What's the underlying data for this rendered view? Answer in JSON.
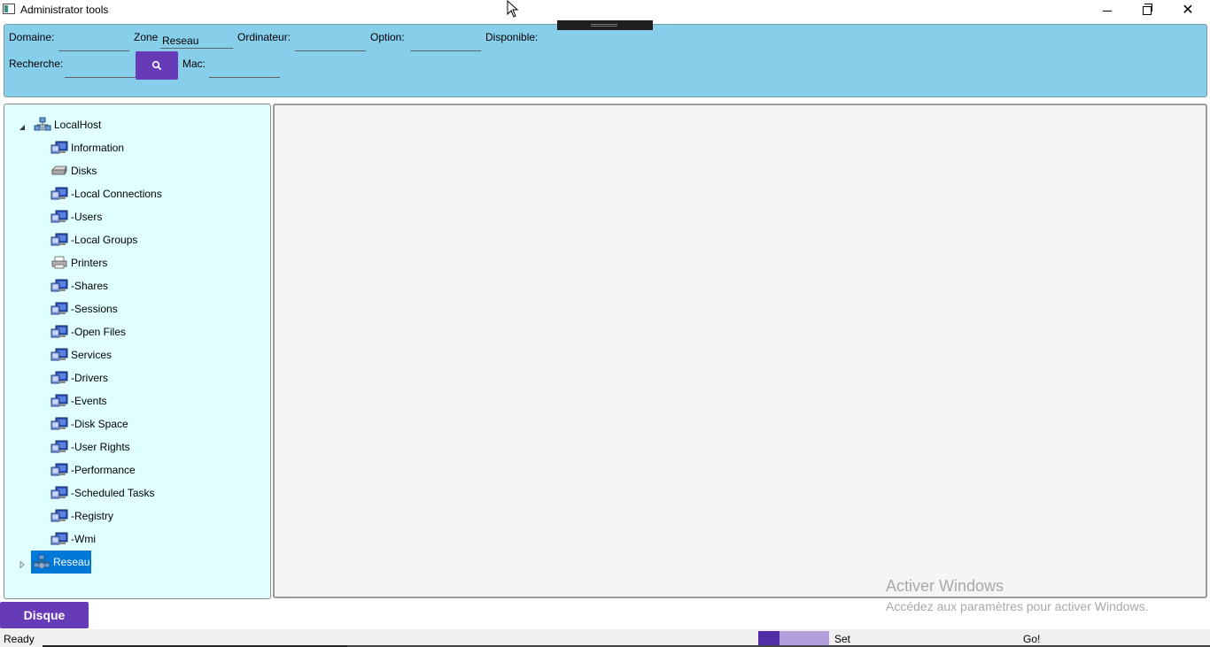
{
  "window": {
    "title": "Administrator tools"
  },
  "filters": {
    "domaine_label": "Domaine:",
    "zone_label": "Zone",
    "zone_value": "Reseau",
    "ordinateur_label": "Ordinateur:",
    "option_label": "Option:",
    "disponible_label": "Disponible:",
    "recherche_label": "Recherche:",
    "mac_label": "Mac:"
  },
  "tree": {
    "root": "LocalHost",
    "items": [
      {
        "label": "Information",
        "icon": "computer-icon"
      },
      {
        "label": "Disks",
        "icon": "disk-icon"
      },
      {
        "label": "-Local Connections",
        "icon": "computer-icon"
      },
      {
        "label": "-Users",
        "icon": "computer-icon"
      },
      {
        "label": "-Local Groups",
        "icon": "computer-icon"
      },
      {
        "label": "Printers",
        "icon": "printer-icon"
      },
      {
        "label": "-Shares",
        "icon": "computer-icon"
      },
      {
        "label": "-Sessions",
        "icon": "computer-icon"
      },
      {
        "label": "-Open Files",
        "icon": "computer-icon"
      },
      {
        "label": "Services",
        "icon": "computer-icon"
      },
      {
        "label": "-Drivers",
        "icon": "computer-icon"
      },
      {
        "label": "-Events",
        "icon": "computer-icon"
      },
      {
        "label": "-Disk Space",
        "icon": "computer-icon"
      },
      {
        "label": "-User Rights",
        "icon": "computer-icon"
      },
      {
        "label": "-Performance",
        "icon": "computer-icon"
      },
      {
        "label": "-Scheduled Tasks",
        "icon": "computer-icon"
      },
      {
        "label": "-Registry",
        "icon": "computer-icon"
      },
      {
        "label": "-Wmi",
        "icon": "computer-icon"
      }
    ],
    "second_root": "Reseau"
  },
  "watermark": {
    "title": "Activer Windows",
    "subtitle": "Accédez aux paramètres pour activer Windows."
  },
  "bottom": {
    "disque_label": "Disque",
    "status": "Ready",
    "progress": 0.3,
    "set_label": "Set",
    "go_label": "Go!"
  },
  "colors": {
    "filter_panel": "#87ceeb",
    "tree_panel": "#e0ffff",
    "accent": "#673ab7",
    "selection": "#0078d7"
  }
}
